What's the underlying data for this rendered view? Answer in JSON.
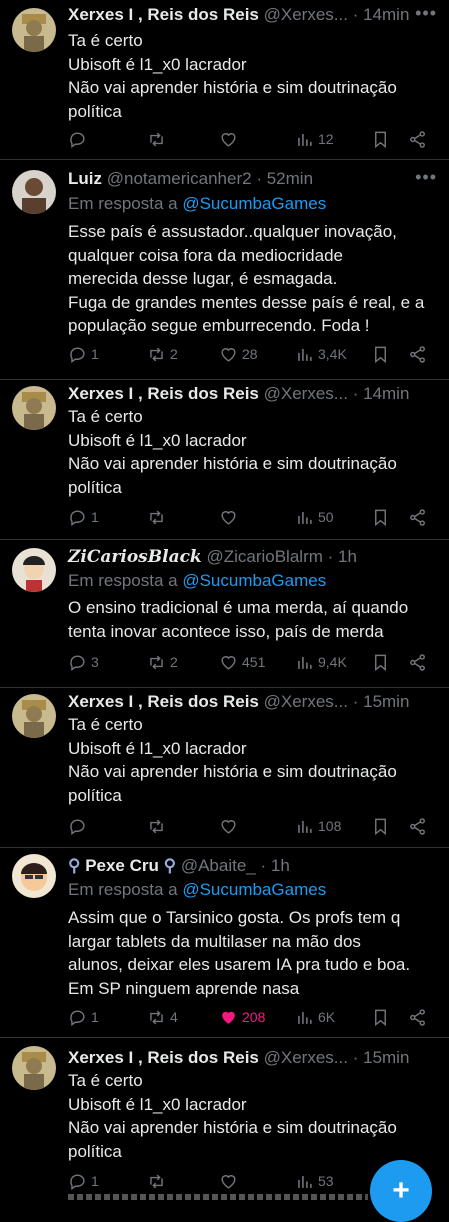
{
  "colors": {
    "accent": "#1d9bf0",
    "muted": "#71767b",
    "like": "#f91880",
    "bg": "#000000"
  },
  "tweets": [
    {
      "name": "Xerxes I , Reis dos Reis",
      "handle": "@Xerxes...",
      "sep": "·",
      "time": "14min",
      "reply_prefix": "",
      "reply_mention": "",
      "lines": [
        "Ta é certo",
        "Ubisoft é l1_x0 lacrador",
        "Não vai aprender história e sim doutrinação",
        "política"
      ],
      "replies": "",
      "retweets": "",
      "likes": "",
      "views": "12",
      "liked": false
    },
    {
      "name": "Luiz",
      "handle": "@notamericanher2",
      "sep": "·",
      "time": "52min",
      "reply_prefix": "Em resposta a ",
      "reply_mention": "@SucumbaGames",
      "lines": [
        "Esse país é assustador..qualquer inovação,",
        "qualquer coisa fora da mediocridade",
        "merecida desse lugar, é esmagada.",
        "Fuga de grandes mentes desse país é real, e a",
        "população segue emburrecendo. Foda !"
      ],
      "replies": "1",
      "retweets": "2",
      "likes": "28",
      "views": "3,4K",
      "liked": false
    },
    {
      "name": "Xerxes I , Reis dos Reis",
      "handle": "@Xerxes...",
      "sep": "·",
      "time": "14min",
      "reply_prefix": "",
      "reply_mention": "",
      "lines": [
        "Ta é certo",
        "Ubisoft é l1_x0 lacrador",
        "Não vai aprender história e sim doutrinação",
        "política"
      ],
      "replies": "1",
      "retweets": "",
      "likes": "",
      "views": "50",
      "liked": false
    },
    {
      "name": "ZiCariosBlack",
      "handle": "@ZicarioBlalrm",
      "sep": "·",
      "time": "1h",
      "reply_prefix": "Em resposta a ",
      "reply_mention": "@SucumbaGames",
      "lines": [
        "O ensino tradicional é uma merda, aí quando",
        "tenta inovar acontece isso, país de merda"
      ],
      "replies": "3",
      "retweets": "2",
      "likes": "451",
      "views": "9,4K",
      "liked": false
    },
    {
      "name": "Xerxes I , Reis dos Reis",
      "handle": "@Xerxes...",
      "sep": "·",
      "time": "15min",
      "reply_prefix": "",
      "reply_mention": "",
      "lines": [
        "Ta é certo",
        "Ubisoft é l1_x0 lacrador",
        "Não vai aprender história e sim doutrinação",
        "política"
      ],
      "replies": "",
      "retweets": "",
      "likes": "",
      "views": "108",
      "liked": false
    },
    {
      "name": "Pexe Cru",
      "handle": "@Abaite_",
      "sep": "·",
      "time": "1h",
      "reply_prefix": "Em resposta a ",
      "reply_mention": "@SucumbaGames",
      "lines": [
        "Assim que o Tarsinico gosta. Os profs tem q",
        "largar tablets da multilaser na mão dos",
        "alunos, deixar eles usarem IA pra tudo e boa.",
        "Em SP ninguem aprende nasa"
      ],
      "replies": "1",
      "retweets": "4",
      "likes": "208",
      "views": "6K",
      "liked": true
    },
    {
      "name": "Xerxes I , Reis dos Reis",
      "handle": "@Xerxes...",
      "sep": "·",
      "time": "15min",
      "reply_prefix": "",
      "reply_mention": "",
      "lines": [
        "Ta é certo",
        "Ubisoft é l1_x0 lacrador",
        "Não vai aprender história e sim doutrinação",
        "política"
      ],
      "replies": "1",
      "retweets": "",
      "likes": "",
      "views": "53",
      "liked": false
    }
  ],
  "fab": {
    "label": "+"
  }
}
